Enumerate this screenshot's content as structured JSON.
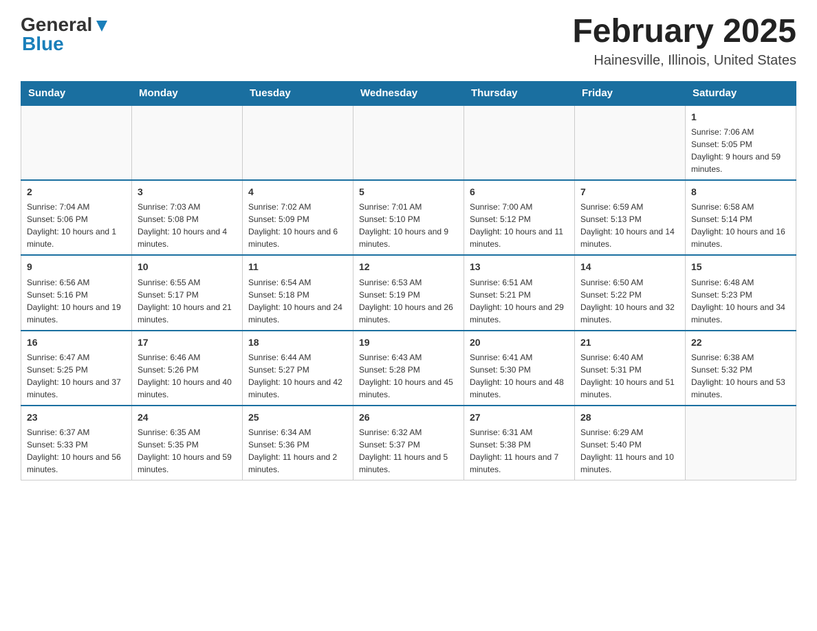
{
  "logo": {
    "text_general": "General",
    "text_blue": "Blue"
  },
  "header": {
    "month_title": "February 2025",
    "location": "Hainesville, Illinois, United States"
  },
  "weekdays": [
    "Sunday",
    "Monday",
    "Tuesday",
    "Wednesday",
    "Thursday",
    "Friday",
    "Saturday"
  ],
  "weeks": [
    [
      {
        "day": "",
        "info": ""
      },
      {
        "day": "",
        "info": ""
      },
      {
        "day": "",
        "info": ""
      },
      {
        "day": "",
        "info": ""
      },
      {
        "day": "",
        "info": ""
      },
      {
        "day": "",
        "info": ""
      },
      {
        "day": "1",
        "info": "Sunrise: 7:06 AM\nSunset: 5:05 PM\nDaylight: 9 hours and 59 minutes."
      }
    ],
    [
      {
        "day": "2",
        "info": "Sunrise: 7:04 AM\nSunset: 5:06 PM\nDaylight: 10 hours and 1 minute."
      },
      {
        "day": "3",
        "info": "Sunrise: 7:03 AM\nSunset: 5:08 PM\nDaylight: 10 hours and 4 minutes."
      },
      {
        "day": "4",
        "info": "Sunrise: 7:02 AM\nSunset: 5:09 PM\nDaylight: 10 hours and 6 minutes."
      },
      {
        "day": "5",
        "info": "Sunrise: 7:01 AM\nSunset: 5:10 PM\nDaylight: 10 hours and 9 minutes."
      },
      {
        "day": "6",
        "info": "Sunrise: 7:00 AM\nSunset: 5:12 PM\nDaylight: 10 hours and 11 minutes."
      },
      {
        "day": "7",
        "info": "Sunrise: 6:59 AM\nSunset: 5:13 PM\nDaylight: 10 hours and 14 minutes."
      },
      {
        "day": "8",
        "info": "Sunrise: 6:58 AM\nSunset: 5:14 PM\nDaylight: 10 hours and 16 minutes."
      }
    ],
    [
      {
        "day": "9",
        "info": "Sunrise: 6:56 AM\nSunset: 5:16 PM\nDaylight: 10 hours and 19 minutes."
      },
      {
        "day": "10",
        "info": "Sunrise: 6:55 AM\nSunset: 5:17 PM\nDaylight: 10 hours and 21 minutes."
      },
      {
        "day": "11",
        "info": "Sunrise: 6:54 AM\nSunset: 5:18 PM\nDaylight: 10 hours and 24 minutes."
      },
      {
        "day": "12",
        "info": "Sunrise: 6:53 AM\nSunset: 5:19 PM\nDaylight: 10 hours and 26 minutes."
      },
      {
        "day": "13",
        "info": "Sunrise: 6:51 AM\nSunset: 5:21 PM\nDaylight: 10 hours and 29 minutes."
      },
      {
        "day": "14",
        "info": "Sunrise: 6:50 AM\nSunset: 5:22 PM\nDaylight: 10 hours and 32 minutes."
      },
      {
        "day": "15",
        "info": "Sunrise: 6:48 AM\nSunset: 5:23 PM\nDaylight: 10 hours and 34 minutes."
      }
    ],
    [
      {
        "day": "16",
        "info": "Sunrise: 6:47 AM\nSunset: 5:25 PM\nDaylight: 10 hours and 37 minutes."
      },
      {
        "day": "17",
        "info": "Sunrise: 6:46 AM\nSunset: 5:26 PM\nDaylight: 10 hours and 40 minutes."
      },
      {
        "day": "18",
        "info": "Sunrise: 6:44 AM\nSunset: 5:27 PM\nDaylight: 10 hours and 42 minutes."
      },
      {
        "day": "19",
        "info": "Sunrise: 6:43 AM\nSunset: 5:28 PM\nDaylight: 10 hours and 45 minutes."
      },
      {
        "day": "20",
        "info": "Sunrise: 6:41 AM\nSunset: 5:30 PM\nDaylight: 10 hours and 48 minutes."
      },
      {
        "day": "21",
        "info": "Sunrise: 6:40 AM\nSunset: 5:31 PM\nDaylight: 10 hours and 51 minutes."
      },
      {
        "day": "22",
        "info": "Sunrise: 6:38 AM\nSunset: 5:32 PM\nDaylight: 10 hours and 53 minutes."
      }
    ],
    [
      {
        "day": "23",
        "info": "Sunrise: 6:37 AM\nSunset: 5:33 PM\nDaylight: 10 hours and 56 minutes."
      },
      {
        "day": "24",
        "info": "Sunrise: 6:35 AM\nSunset: 5:35 PM\nDaylight: 10 hours and 59 minutes."
      },
      {
        "day": "25",
        "info": "Sunrise: 6:34 AM\nSunset: 5:36 PM\nDaylight: 11 hours and 2 minutes."
      },
      {
        "day": "26",
        "info": "Sunrise: 6:32 AM\nSunset: 5:37 PM\nDaylight: 11 hours and 5 minutes."
      },
      {
        "day": "27",
        "info": "Sunrise: 6:31 AM\nSunset: 5:38 PM\nDaylight: 11 hours and 7 minutes."
      },
      {
        "day": "28",
        "info": "Sunrise: 6:29 AM\nSunset: 5:40 PM\nDaylight: 11 hours and 10 minutes."
      },
      {
        "day": "",
        "info": ""
      }
    ]
  ]
}
